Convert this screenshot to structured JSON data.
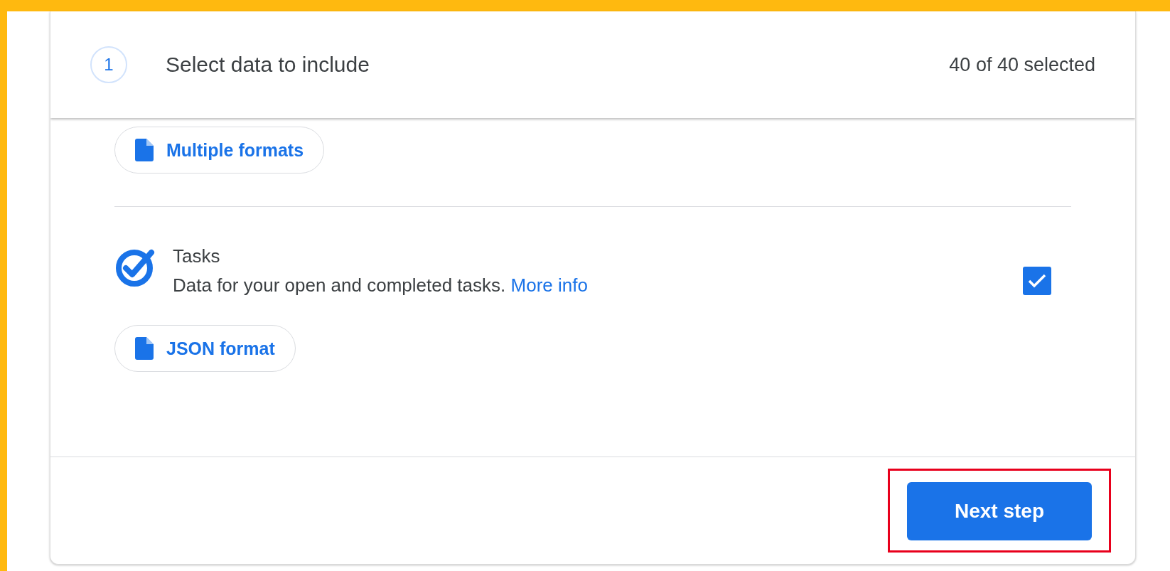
{
  "header": {
    "step": "1",
    "title": "Select data to include",
    "count": "40 of 40 selected"
  },
  "items": [
    {
      "kind": "format_only",
      "format": "Multiple formats"
    },
    {
      "kind": "product",
      "title": "Tasks",
      "description": "Data for your open and completed tasks.",
      "link": "More info",
      "checked": true,
      "format": "JSON format"
    }
  ],
  "footer": {
    "button": "Next step",
    "highlighted": true
  }
}
